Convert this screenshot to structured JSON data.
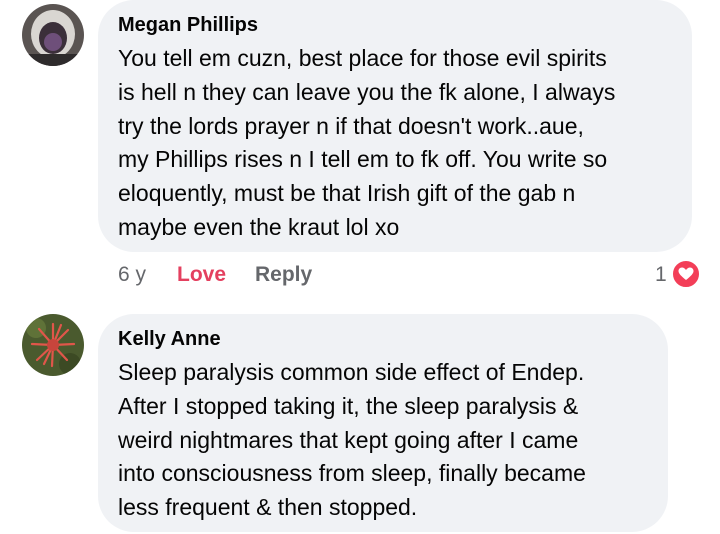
{
  "comments": [
    {
      "author": "Megan Phillips",
      "lines": [
        "You tell em cuzn, best place for those evil spirits",
        "is hell n they can leave you the fk alone, I always",
        "try the lords prayer n if that doesn't work..aue,",
        "my Phillips rises n I tell em to fk off. You write so",
        "eloquently, must be that Irish gift of the gab n",
        "maybe even the kraut lol xo"
      ],
      "time": "6 y",
      "reaction_label": "Love",
      "reply_label": "Reply",
      "reaction_count": "1",
      "reaction_icon": "heart-icon",
      "reaction_color": "#f33e58",
      "reaction_label_color": "#e4405f"
    },
    {
      "author": "Kelly Anne",
      "lines": [
        "Sleep paralysis common side effect of Endep.",
        "After I stopped taking it, the sleep paralysis &",
        "weird nightmares that kept going after I came",
        "into consciousness from sleep, finally became",
        "less frequent & then stopped."
      ]
    }
  ],
  "colors": {
    "bubble": "#f0f2f5",
    "text": "#050505",
    "secondary": "#65676b"
  }
}
